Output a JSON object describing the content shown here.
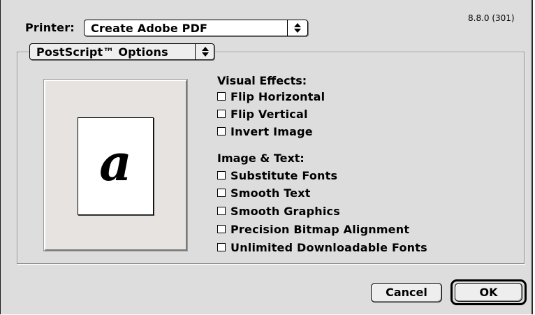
{
  "printer": {
    "label": "Printer:",
    "selected": "Create Adobe PDF"
  },
  "version": "8.8.0 (301)",
  "panel_menu": {
    "selected": "PostScript™ Options"
  },
  "preview": {
    "glyph": "a"
  },
  "visual_effects": {
    "title": "Visual Effects:",
    "items": [
      {
        "label": "Flip Horizontal",
        "checked": false
      },
      {
        "label": "Flip Vertical",
        "checked": false
      },
      {
        "label": "Invert Image",
        "checked": false
      }
    ]
  },
  "image_text": {
    "title": "Image & Text:",
    "items": [
      {
        "label": "Substitute Fonts",
        "checked": false
      },
      {
        "label": "Smooth Text",
        "checked": false
      },
      {
        "label": "Smooth Graphics",
        "checked": false
      },
      {
        "label": "Precision Bitmap Alignment",
        "checked": false
      },
      {
        "label": "Unlimited Downloadable Fonts",
        "checked": false
      }
    ]
  },
  "buttons": {
    "cancel": "Cancel",
    "ok": "OK"
  },
  "icons": {
    "popup_arrows": "up-down-arrows-icon"
  },
  "colors": {
    "dialog_background": "#dddddd",
    "preview_frame": "#e6e3e0"
  }
}
